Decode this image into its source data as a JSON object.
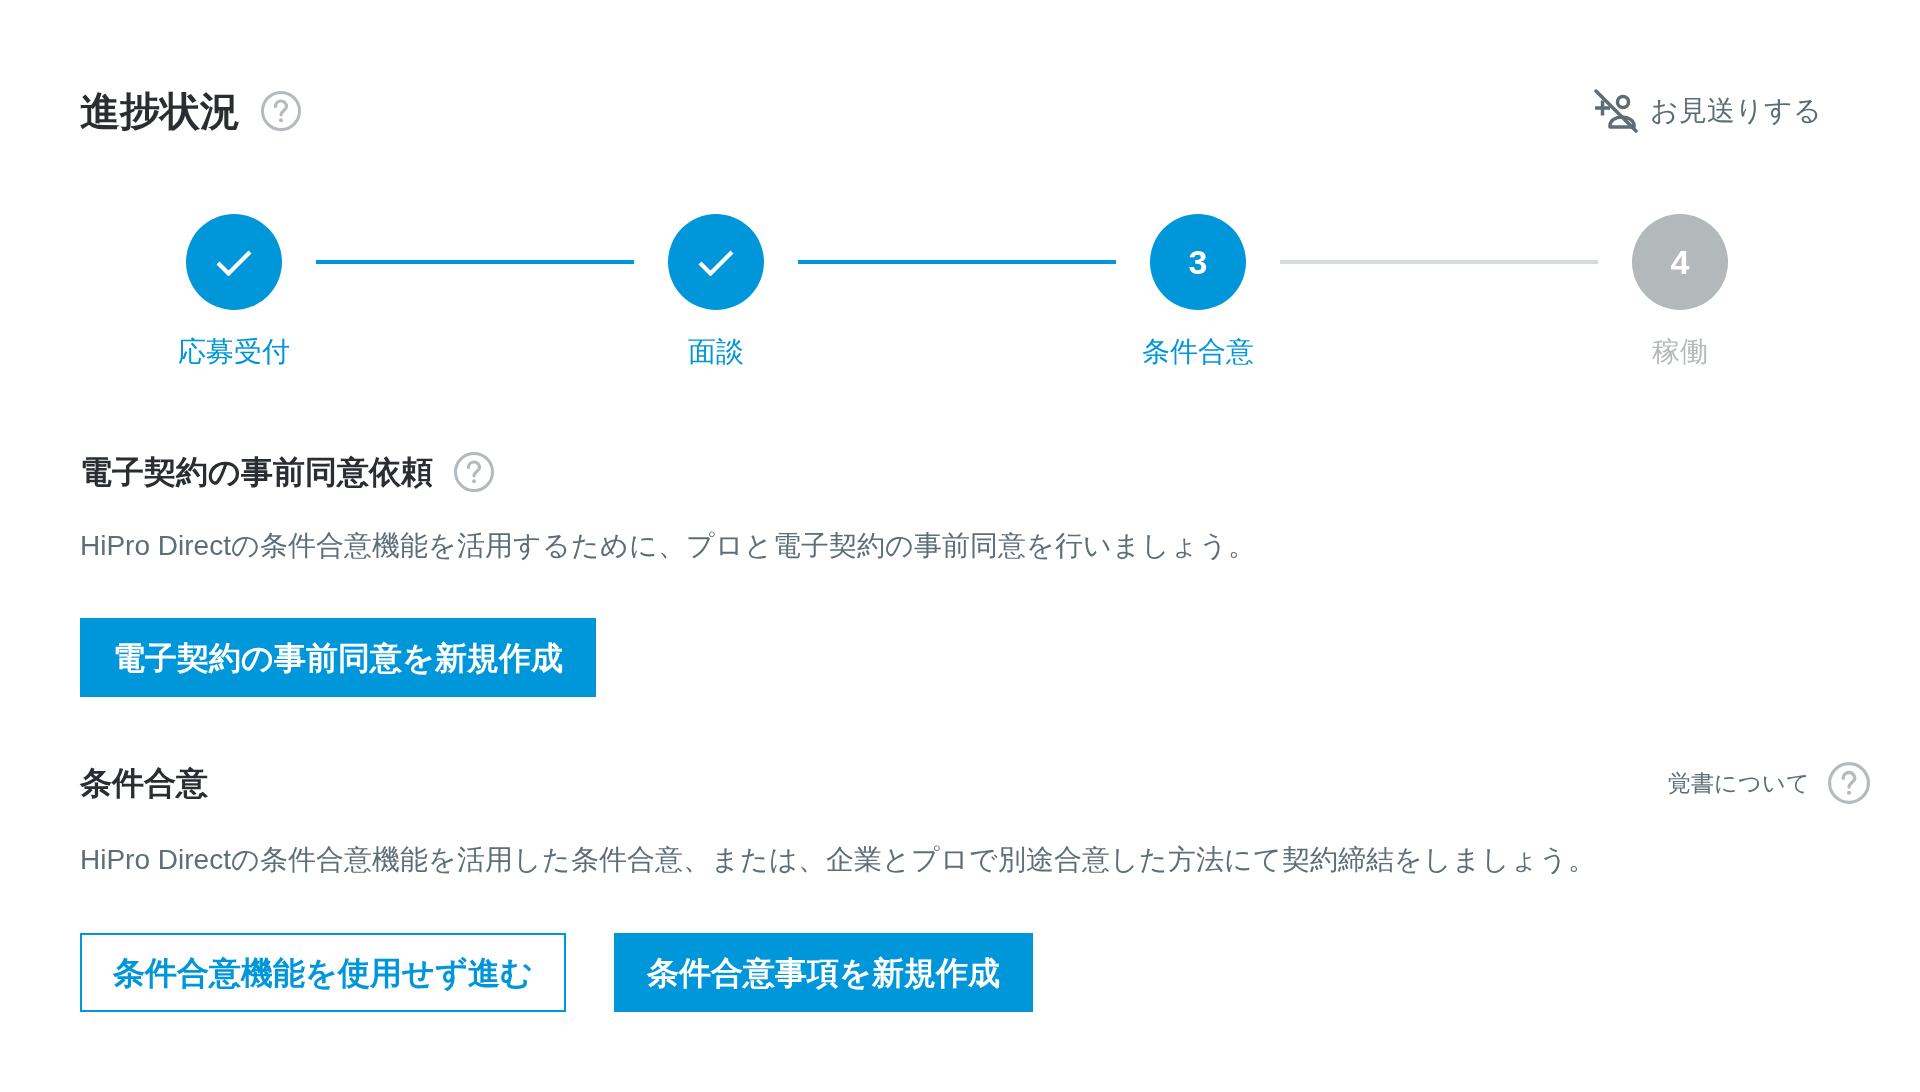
{
  "header": {
    "title": "進捗状況",
    "decline_action": {
      "label": "お見送りする"
    }
  },
  "progress_steps": [
    {
      "label": "応募受付",
      "completed": true,
      "active": true
    },
    {
      "label": "面談",
      "completed": true,
      "active": true
    },
    {
      "label": "条件合意",
      "completed": false,
      "active": true,
      "number": "3"
    },
    {
      "label": "稼働",
      "completed": false,
      "active": false,
      "number": "4"
    }
  ],
  "pre_consent": {
    "heading": "電子契約の事前同意依頼",
    "description": "HiPro Directの条件合意機能を活用するために、プロと電子契約の事前同意を行いましょう。",
    "buttons": [
      {
        "label": "電子契約の事前同意を新規作成",
        "kind": "primary"
      }
    ]
  },
  "agreement": {
    "heading": "条件合意",
    "help_link": "覚書について",
    "description": "HiPro Directの条件合意機能を活用した条件合意、または、企業とプロで別途合意した方法にて契約締結をしましょう。",
    "buttons": [
      {
        "label": "条件合意機能を使用せず進む",
        "kind": "outline"
      },
      {
        "label": "条件合意事項を新規作成",
        "kind": "primary"
      }
    ]
  }
}
